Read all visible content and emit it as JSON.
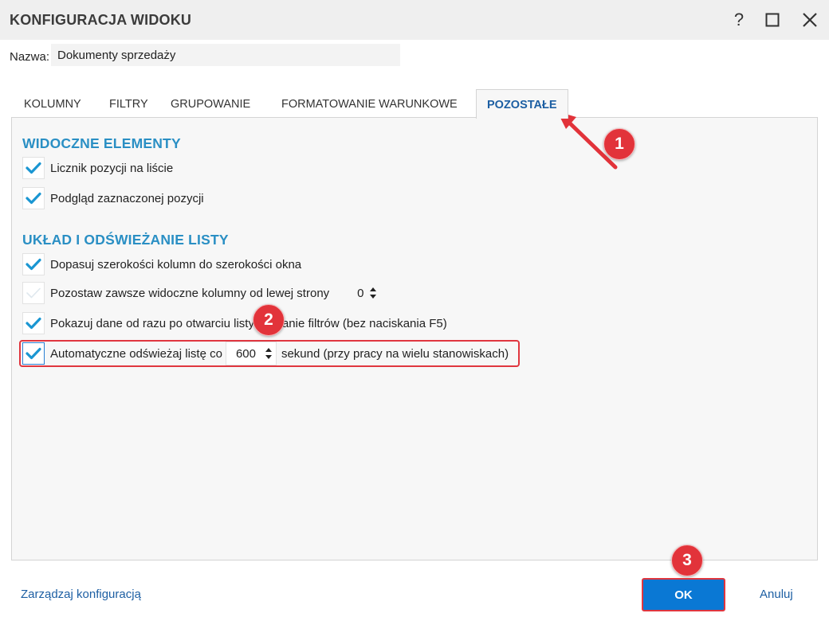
{
  "window": {
    "title": "KONFIGURACJA WIDOKU"
  },
  "name_field": {
    "label": "Nazwa:",
    "value": "Dokumenty sprzedaży"
  },
  "tabs": [
    {
      "label": "KOLUMNY",
      "active": false
    },
    {
      "label": "FILTRY",
      "active": false
    },
    {
      "label": "GRUPOWANIE",
      "active": false
    },
    {
      "label": "FORMATOWANIE WARUNKOWE",
      "active": false
    },
    {
      "label": "POZOSTAŁE",
      "active": true
    }
  ],
  "sections": {
    "visible": {
      "heading": "WIDOCZNE ELEMENTY",
      "items": [
        {
          "label": "Licznik pozycji na liście",
          "checked": true
        },
        {
          "label": "Podgląd zaznaczonej pozycji",
          "checked": true
        }
      ]
    },
    "layout": {
      "heading": "UKŁAD I ODŚWIEŻANIE LISTY",
      "items": [
        {
          "label": "Dopasuj szerokości kolumn do szerokości okna",
          "checked": true
        },
        {
          "label": "Pozostaw zawsze widoczne kolumny od lewej strony",
          "checked": false,
          "value": "0"
        },
        {
          "label": "Pokazuj dane od razu po otwarciu listy i zmianie filtrów (bez naciskania F5)",
          "checked": true
        },
        {
          "label": "Automatyczne odświeżaj listę co",
          "checked": true,
          "value": "600",
          "suffix": "sekund (przy pracy na wielu stanowiskach)"
        }
      ]
    }
  },
  "annotations": {
    "badge1": "1",
    "badge2": "2",
    "badge3": "3"
  },
  "footer": {
    "manage_link": "Zarządzaj konfiguracją",
    "ok_label": "OK",
    "cancel_label": "Anuluj"
  },
  "colors": {
    "accent": "#0a78d4",
    "heading": "#2a8fc4",
    "highlight": "#e0363f",
    "check": "#1a96d2"
  },
  "icons": [
    "help-icon",
    "maximize-icon",
    "close-icon",
    "checkmark-icon",
    "spin-arrows-icon",
    "arrow-annotation-icon"
  ]
}
